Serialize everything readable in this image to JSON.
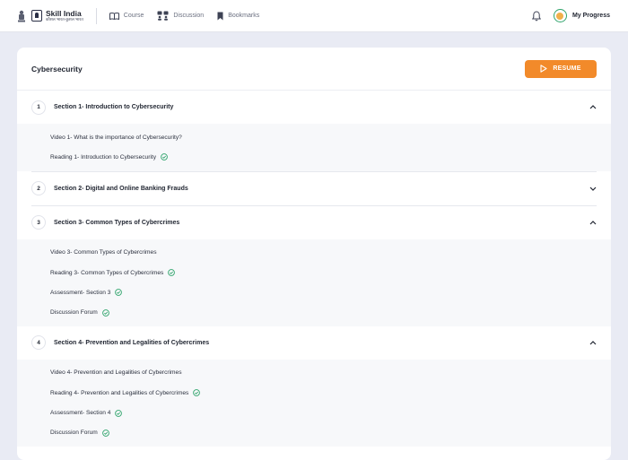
{
  "brand": {
    "name": "Skill India",
    "subtitle": "कौशल भारत-कुशल भारत"
  },
  "nav": [
    {
      "label": "Course",
      "icon": "book-icon"
    },
    {
      "label": "Discussion",
      "icon": "people-icon"
    },
    {
      "label": "Bookmarks",
      "icon": "bookmark-icon"
    }
  ],
  "user": {
    "progress_label": "My Progress"
  },
  "course": {
    "title": "Cybersecurity",
    "resume_label": "RESUME",
    "accent": "#f28a2a",
    "check_color": "#30a46c"
  },
  "sections": [
    {
      "number": "1",
      "title": "Section 1- Introduction to Cybersecurity",
      "expanded": true,
      "items": [
        {
          "label": "Video 1- What is the importance of Cybersecurity?",
          "completed": false
        },
        {
          "label": "Reading 1- Introduction to Cybersecurity",
          "completed": true
        }
      ]
    },
    {
      "number": "2",
      "title": "Section 2- Digital and Online Banking Frauds",
      "expanded": false,
      "items": []
    },
    {
      "number": "3",
      "title": "Section 3- Common Types of Cybercrimes",
      "expanded": true,
      "items": [
        {
          "label": "Video 3- Common Types of Cybercrimes",
          "completed": false
        },
        {
          "label": "Reading 3- Common Types of Cybercrimes",
          "completed": true
        },
        {
          "label": "Assessment- Section 3",
          "completed": true
        },
        {
          "label": "Discussion Forum",
          "completed": true
        }
      ]
    },
    {
      "number": "4",
      "title": "Section 4- Prevention and Legalities of Cybercrimes",
      "expanded": true,
      "items": [
        {
          "label": "Video 4- Prevention and Legalities of Cybercrimes",
          "completed": false
        },
        {
          "label": "Reading 4- Prevention and Legalities of Cybercrimes",
          "completed": true
        },
        {
          "label": "Assessment- Section 4",
          "completed": true
        },
        {
          "label": "Discussion Forum",
          "completed": true
        }
      ]
    }
  ]
}
